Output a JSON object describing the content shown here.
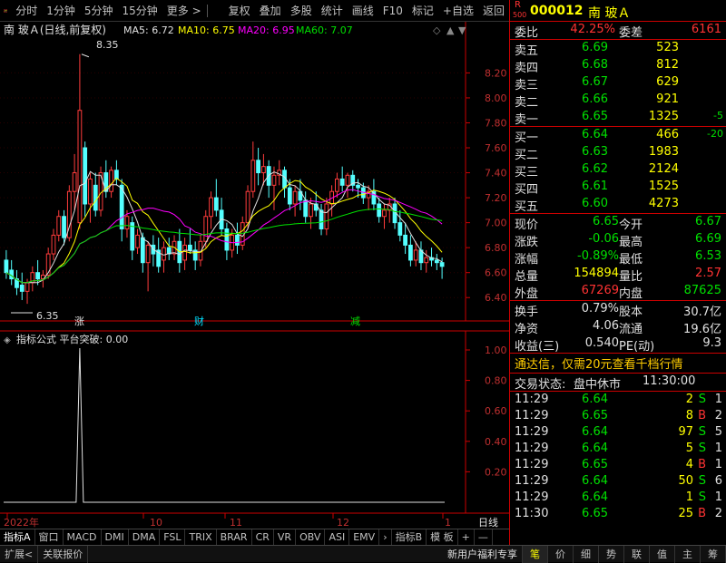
{
  "topbar": {
    "items": [
      "分时",
      "1分钟",
      "5分钟",
      "15分钟",
      "更多 >",
      "复权",
      "叠加",
      "多股",
      "统计",
      "画线",
      "F10",
      "标记",
      "+自选",
      "返回"
    ]
  },
  "chart": {
    "title": "南 玻Ａ(日线,前复权)",
    "ma5": "MA5: 6.72",
    "ma10": "MA10: 6.75",
    "ma20": "MA20: 6.95",
    "ma60": "MA60: 7.07",
    "max_label": "8.35",
    "min_label": "6.35",
    "price_axis": [
      "8.20",
      "8.00",
      "7.80",
      "7.60",
      "7.40",
      "7.20",
      "7.00",
      "6.80",
      "6.60",
      "6.40"
    ],
    "events": [
      "涨",
      "财",
      "减"
    ],
    "ind_title": "指标公式  平台突破: 0.00",
    "ind_axis": [
      "1.00",
      "0.80",
      "0.60",
      "0.40",
      "0.20"
    ],
    "x_labels": [
      "2022年",
      "10",
      "11",
      "12",
      "1"
    ],
    "period": "日线"
  },
  "chart_data": {
    "type": "candlestick",
    "series": [
      {
        "o": 6.7,
        "h": 6.78,
        "l": 6.55,
        "c": 6.6
      },
      {
        "o": 6.62,
        "h": 6.7,
        "l": 6.5,
        "c": 6.55
      },
      {
        "o": 6.55,
        "h": 6.62,
        "l": 6.42,
        "c": 6.48
      },
      {
        "o": 6.5,
        "h": 6.6,
        "l": 6.38,
        "c": 6.45
      },
      {
        "o": 6.45,
        "h": 6.55,
        "l": 6.35,
        "c": 6.52
      },
      {
        "o": 6.52,
        "h": 6.65,
        "l": 6.45,
        "c": 6.6
      },
      {
        "o": 6.6,
        "h": 6.7,
        "l": 6.5,
        "c": 6.55
      },
      {
        "o": 6.55,
        "h": 6.62,
        "l": 6.48,
        "c": 6.58
      },
      {
        "o": 6.58,
        "h": 6.8,
        "l": 6.55,
        "c": 6.75
      },
      {
        "o": 6.75,
        "h": 6.95,
        "l": 6.7,
        "c": 6.9
      },
      {
        "o": 6.9,
        "h": 7.1,
        "l": 6.85,
        "c": 7.05
      },
      {
        "o": 7.05,
        "h": 7.1,
        "l": 6.82,
        "c": 6.88
      },
      {
        "o": 6.88,
        "h": 7.3,
        "l": 6.85,
        "c": 7.25
      },
      {
        "o": 7.25,
        "h": 7.55,
        "l": 7.1,
        "c": 7.4
      },
      {
        "o": 7.0,
        "h": 8.35,
        "l": 6.95,
        "c": 7.9
      },
      {
        "o": 7.6,
        "h": 7.65,
        "l": 7.05,
        "c": 7.15
      },
      {
        "o": 7.15,
        "h": 7.4,
        "l": 7.0,
        "c": 7.35
      },
      {
        "o": 7.3,
        "h": 7.4,
        "l": 7.05,
        "c": 7.1
      },
      {
        "o": 7.1,
        "h": 7.45,
        "l": 7.05,
        "c": 7.4
      },
      {
        "o": 7.4,
        "h": 7.5,
        "l": 7.2,
        "c": 7.25
      },
      {
        "o": 7.25,
        "h": 7.45,
        "l": 7.2,
        "c": 7.42
      },
      {
        "o": 7.42,
        "h": 7.5,
        "l": 7.3,
        "c": 7.35
      },
      {
        "o": 7.3,
        "h": 7.35,
        "l": 6.85,
        "c": 6.95
      },
      {
        "o": 6.95,
        "h": 7.1,
        "l": 6.88,
        "c": 7.05
      },
      {
        "o": 7.0,
        "h": 7.05,
        "l": 6.7,
        "c": 6.78
      },
      {
        "o": 6.8,
        "h": 6.95,
        "l": 6.75,
        "c": 6.9
      },
      {
        "o": 6.88,
        "h": 6.92,
        "l": 6.6,
        "c": 6.68
      },
      {
        "o": 6.68,
        "h": 6.85,
        "l": 6.45,
        "c": 6.82
      },
      {
        "o": 6.82,
        "h": 6.9,
        "l": 6.65,
        "c": 6.75
      },
      {
        "o": 6.78,
        "h": 6.88,
        "l": 6.6,
        "c": 6.65
      },
      {
        "o": 6.7,
        "h": 6.85,
        "l": 6.6,
        "c": 6.8
      },
      {
        "o": 6.8,
        "h": 6.88,
        "l": 6.7,
        "c": 6.75
      },
      {
        "o": 6.75,
        "h": 6.9,
        "l": 6.7,
        "c": 6.85
      },
      {
        "o": 6.85,
        "h": 6.95,
        "l": 6.6,
        "c": 6.68
      },
      {
        "o": 6.7,
        "h": 6.88,
        "l": 6.62,
        "c": 6.82
      },
      {
        "o": 6.82,
        "h": 6.95,
        "l": 6.75,
        "c": 6.78
      },
      {
        "o": 6.78,
        "h": 6.85,
        "l": 6.62,
        "c": 6.7
      },
      {
        "o": 6.7,
        "h": 6.9,
        "l": 6.65,
        "c": 6.85
      },
      {
        "o": 6.85,
        "h": 7.1,
        "l": 6.8,
        "c": 7.05
      },
      {
        "o": 7.05,
        "h": 7.25,
        "l": 6.95,
        "c": 7.2
      },
      {
        "o": 7.2,
        "h": 7.35,
        "l": 7.05,
        "c": 7.1
      },
      {
        "o": 7.1,
        "h": 7.2,
        "l": 6.9,
        "c": 6.95
      },
      {
        "o": 6.95,
        "h": 7.0,
        "l": 6.7,
        "c": 6.78
      },
      {
        "o": 6.78,
        "h": 6.95,
        "l": 6.72,
        "c": 6.9
      },
      {
        "o": 6.9,
        "h": 7.0,
        "l": 6.75,
        "c": 6.82
      },
      {
        "o": 6.82,
        "h": 7.05,
        "l": 6.78,
        "c": 7.0
      },
      {
        "o": 7.0,
        "h": 7.3,
        "l": 6.95,
        "c": 7.25
      },
      {
        "o": 7.25,
        "h": 7.65,
        "l": 7.2,
        "c": 7.5
      },
      {
        "o": 7.5,
        "h": 7.6,
        "l": 7.3,
        "c": 7.4
      },
      {
        "o": 7.4,
        "h": 7.55,
        "l": 7.3,
        "c": 7.45
      },
      {
        "o": 7.45,
        "h": 7.5,
        "l": 7.2,
        "c": 7.3
      },
      {
        "o": 7.3,
        "h": 7.45,
        "l": 7.1,
        "c": 7.38
      },
      {
        "o": 7.38,
        "h": 7.5,
        "l": 7.3,
        "c": 7.42
      },
      {
        "o": 7.42,
        "h": 7.45,
        "l": 7.2,
        "c": 7.28
      },
      {
        "o": 7.28,
        "h": 7.35,
        "l": 7.1,
        "c": 7.15
      },
      {
        "o": 7.15,
        "h": 7.3,
        "l": 7.05,
        "c": 7.25
      },
      {
        "o": 7.25,
        "h": 7.35,
        "l": 7.1,
        "c": 7.18
      },
      {
        "o": 7.18,
        "h": 7.25,
        "l": 7.0,
        "c": 7.05
      },
      {
        "o": 7.05,
        "h": 7.2,
        "l": 6.95,
        "c": 7.15
      },
      {
        "o": 7.15,
        "h": 7.25,
        "l": 7.05,
        "c": 7.1
      },
      {
        "o": 7.1,
        "h": 7.15,
        "l": 6.9,
        "c": 6.95
      },
      {
        "o": 6.95,
        "h": 7.2,
        "l": 6.9,
        "c": 7.15
      },
      {
        "o": 7.15,
        "h": 7.3,
        "l": 7.05,
        "c": 7.25
      },
      {
        "o": 7.25,
        "h": 7.4,
        "l": 7.2,
        "c": 7.35
      },
      {
        "o": 7.35,
        "h": 7.45,
        "l": 7.25,
        "c": 7.3
      },
      {
        "o": 7.3,
        "h": 7.4,
        "l": 7.2,
        "c": 7.38
      },
      {
        "o": 7.38,
        "h": 7.42,
        "l": 7.25,
        "c": 7.3
      },
      {
        "o": 7.3,
        "h": 7.35,
        "l": 7.2,
        "c": 7.28
      },
      {
        "o": 7.28,
        "h": 7.32,
        "l": 7.15,
        "c": 7.2
      },
      {
        "o": 7.2,
        "h": 7.3,
        "l": 7.1,
        "c": 7.25
      },
      {
        "o": 7.25,
        "h": 7.35,
        "l": 7.1,
        "c": 7.15
      },
      {
        "o": 7.15,
        "h": 7.2,
        "l": 7.0,
        "c": 7.05
      },
      {
        "o": 7.05,
        "h": 7.15,
        "l": 6.95,
        "c": 7.1
      },
      {
        "o": 7.1,
        "h": 7.2,
        "l": 7.0,
        "c": 7.15
      },
      {
        "o": 7.15,
        "h": 7.2,
        "l": 6.95,
        "c": 7.0
      },
      {
        "o": 7.0,
        "h": 7.1,
        "l": 6.85,
        "c": 6.9
      },
      {
        "o": 6.9,
        "h": 7.0,
        "l": 6.75,
        "c": 6.82
      },
      {
        "o": 6.82,
        "h": 6.9,
        "l": 6.65,
        "c": 6.7
      },
      {
        "o": 6.7,
        "h": 6.85,
        "l": 6.65,
        "c": 6.78
      },
      {
        "o": 6.78,
        "h": 6.85,
        "l": 6.62,
        "c": 6.68
      },
      {
        "o": 6.68,
        "h": 6.78,
        "l": 6.6,
        "c": 6.72
      },
      {
        "o": 6.72,
        "h": 6.8,
        "l": 6.65,
        "c": 6.7
      },
      {
        "o": 6.7,
        "h": 6.75,
        "l": 6.62,
        "c": 6.68
      },
      {
        "o": 6.68,
        "h": 6.72,
        "l": 6.55,
        "c": 6.65
      }
    ],
    "ind_peak_index": 14,
    "ylim": [
      6.3,
      8.45
    ]
  },
  "quote": {
    "code": "000012",
    "name": "南 玻Ａ",
    "market": "R",
    "market2": "500",
    "webi_label": "委比",
    "webi": "42.25%",
    "weicha_label": "委差",
    "weicha": "6161",
    "sell": [
      {
        "label": "卖五",
        "price": "6.69",
        "vol": "523",
        "chg": ""
      },
      {
        "label": "卖四",
        "price": "6.68",
        "vol": "812",
        "chg": ""
      },
      {
        "label": "卖三",
        "price": "6.67",
        "vol": "629",
        "chg": ""
      },
      {
        "label": "卖二",
        "price": "6.66",
        "vol": "921",
        "chg": ""
      },
      {
        "label": "卖一",
        "price": "6.65",
        "vol": "1325",
        "chg": "-5"
      }
    ],
    "buy": [
      {
        "label": "买一",
        "price": "6.64",
        "vol": "466",
        "chg": "-20"
      },
      {
        "label": "买二",
        "price": "6.63",
        "vol": "1983",
        "chg": ""
      },
      {
        "label": "买三",
        "price": "6.62",
        "vol": "2124",
        "chg": ""
      },
      {
        "label": "买四",
        "price": "6.61",
        "vol": "1525",
        "chg": ""
      },
      {
        "label": "买五",
        "price": "6.60",
        "vol": "4273",
        "chg": ""
      }
    ],
    "stats": [
      {
        "l1": "现价",
        "v1": "6.65",
        "l2": "今开",
        "v2": "6.67",
        "c1": "green",
        "c2": "green"
      },
      {
        "l1": "涨跌",
        "v1": "-0.06",
        "l2": "最高",
        "v2": "6.69",
        "c1": "green",
        "c2": "green"
      },
      {
        "l1": "涨幅",
        "v1": "-0.89%",
        "l2": "最低",
        "v2": "6.53",
        "c1": "green",
        "c2": "green"
      },
      {
        "l1": "总量",
        "v1": "154894",
        "l2": "量比",
        "v2": "2.57",
        "c1": "yellow",
        "c2": "red"
      },
      {
        "l1": "外盘",
        "v1": "67269",
        "l2": "内盘",
        "v2": "87625",
        "c1": "red",
        "c2": "green"
      }
    ],
    "stats2": [
      {
        "l1": "换手",
        "v1": "0.79%",
        "l2": "股本",
        "v2": "30.7亿"
      },
      {
        "l1": "净资",
        "v1": "4.06",
        "l2": "流通",
        "v2": "19.6亿"
      },
      {
        "l1": "收益(三)",
        "v1": "0.540",
        "l2": "PE(动)",
        "v2": "9.3"
      }
    ],
    "promo": "通达信，仅需20元查看千档行情",
    "status_label": "交易状态:",
    "status": "盘中休市",
    "status_time": "11:30:00",
    "trades": [
      {
        "t": "11:29",
        "p": "6.64",
        "v": "2",
        "bs": "S",
        "n": "1"
      },
      {
        "t": "11:29",
        "p": "6.65",
        "v": "8",
        "bs": "B",
        "n": "2"
      },
      {
        "t": "11:29",
        "p": "6.64",
        "v": "97",
        "bs": "S",
        "n": "5"
      },
      {
        "t": "11:29",
        "p": "6.64",
        "v": "5",
        "bs": "S",
        "n": "1"
      },
      {
        "t": "11:29",
        "p": "6.65",
        "v": "4",
        "bs": "B",
        "n": "1"
      },
      {
        "t": "11:29",
        "p": "6.64",
        "v": "50",
        "bs": "S",
        "n": "6"
      },
      {
        "t": "11:29",
        "p": "6.64",
        "v": "1",
        "bs": "S",
        "n": "1"
      },
      {
        "t": "11:30",
        "p": "6.65",
        "v": "25",
        "bs": "B",
        "n": "2"
      }
    ]
  },
  "bottom_tabs": [
    "指标A",
    "窗口",
    "MACD",
    "DMI",
    "DMA",
    "FSL",
    "TRIX",
    "BRAR",
    "CR",
    "VR",
    "OBV",
    "ASI",
    "EMV",
    "›",
    "指标B",
    "模 板",
    "+",
    "—"
  ],
  "bottom2": [
    "扩展<",
    "关联报价"
  ],
  "bottom2_right": "新用户福利专享",
  "right_tabs": [
    "笔",
    "价",
    "细",
    "势",
    "联",
    "值",
    "主",
    "筹"
  ]
}
